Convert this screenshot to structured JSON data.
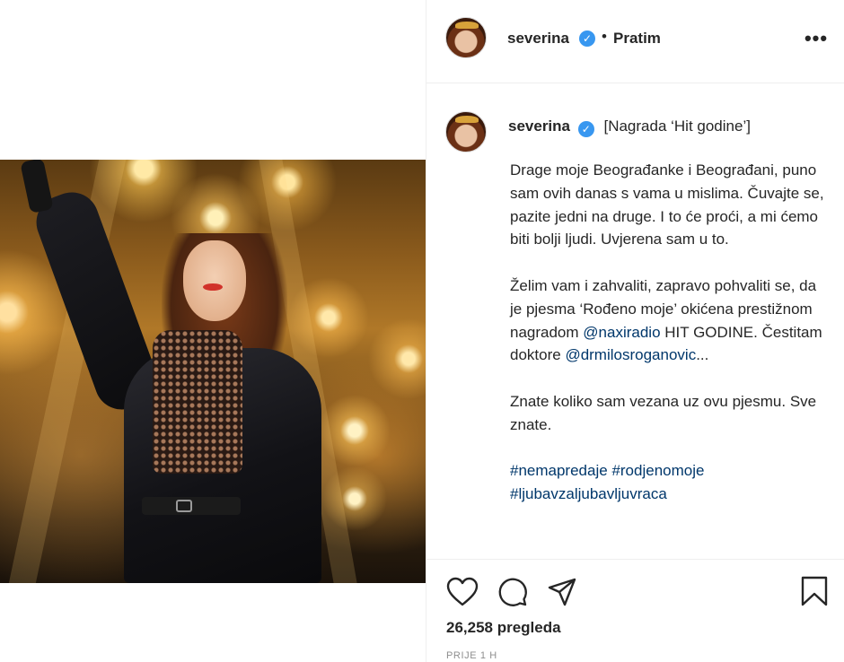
{
  "post": {
    "views": "26,258 pregleda",
    "timestamp": "PRIJE 1 H"
  },
  "header": {
    "username": "severina",
    "verified_mark": "✓",
    "separator": "•",
    "follow_status": "Pratim",
    "more_label": "•••"
  },
  "caption": {
    "username": "severina",
    "verified_mark": "✓",
    "title": "[Nagrada ‘Hit godine’]",
    "para1": "Drage moje Beograđanke i Beograđani, puno sam ovih danas s vama u mislima. Čuvajte se, pazite jedni na druge. I to će proći, a mi ćemo biti bolji ljudi. Uvjerena sam u to.",
    "para2_before": "Želim vam i zahvaliti, zapravo pohvaliti se, da je pjesma ‘Rođeno moje’ okićena prestižnom nagradom",
    "mention1": "@naxiradio",
    "para2_middle": "HIT GODINE. Čestitam doktore",
    "mention2": "@drmilosroganovic",
    "para2_after": "...",
    "para3": "Znate koliko sam vezana uz ovu pjesmu. Sve znate.",
    "hashtag1": "#nemapredaje",
    "hashtag2": "#rodjenomoje",
    "hashtag3": "#ljubavzaljubavljuvraca"
  },
  "icons": {
    "like": "heart-icon",
    "comment": "comment-bubble-icon",
    "share": "paper-plane-icon",
    "save": "bookmark-icon",
    "verified": "verified-badge-icon",
    "more": "ellipsis-icon"
  },
  "colors": {
    "text": "#262626",
    "link": "#00376b",
    "verified": "#3897f0",
    "muted": "#8e8e8e",
    "divider": "#efefef"
  }
}
